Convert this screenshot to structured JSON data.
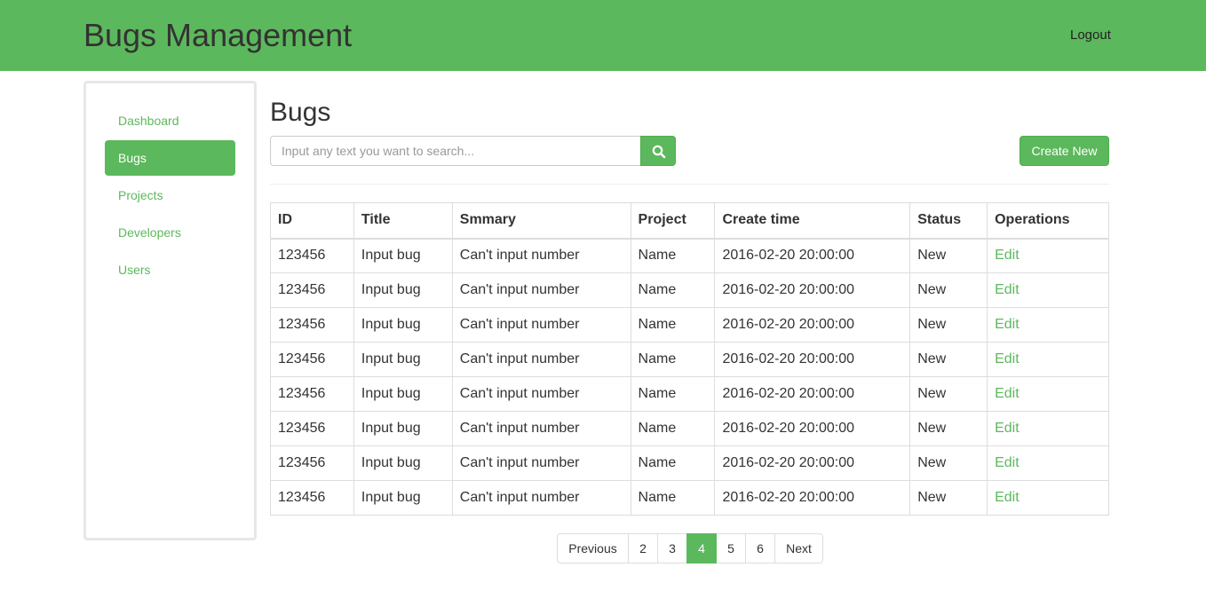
{
  "colors": {
    "accent": "#5cb85c",
    "header_bg": "#5cb85c",
    "border": "#dddddd"
  },
  "header": {
    "title": "Bugs Management",
    "logout_label": "Logout"
  },
  "sidebar": {
    "items": [
      {
        "label": "Dashboard",
        "active": false
      },
      {
        "label": "Bugs",
        "active": true
      },
      {
        "label": "Projects",
        "active": false
      },
      {
        "label": "Developers",
        "active": false
      },
      {
        "label": "Users",
        "active": false
      }
    ]
  },
  "main": {
    "title": "Bugs",
    "search": {
      "placeholder": "Input any text you want to search...",
      "value": "",
      "button_icon": "search-icon"
    },
    "create_label": "Create New"
  },
  "table": {
    "columns": [
      "ID",
      "Title",
      "Smmary",
      "Project",
      "Create time",
      "Status",
      "Operations"
    ],
    "rows": [
      [
        "123456",
        "Input bug",
        "Can't input number",
        "Name",
        "2016-02-20 20:00:00",
        "New",
        "Edit"
      ],
      [
        "123456",
        "Input bug",
        "Can't input number",
        "Name",
        "2016-02-20 20:00:00",
        "New",
        "Edit"
      ],
      [
        "123456",
        "Input bug",
        "Can't input number",
        "Name",
        "2016-02-20 20:00:00",
        "New",
        "Edit"
      ],
      [
        "123456",
        "Input bug",
        "Can't input number",
        "Name",
        "2016-02-20 20:00:00",
        "New",
        "Edit"
      ],
      [
        "123456",
        "Input bug",
        "Can't input number",
        "Name",
        "2016-02-20 20:00:00",
        "New",
        "Edit"
      ],
      [
        "123456",
        "Input bug",
        "Can't input number",
        "Name",
        "2016-02-20 20:00:00",
        "New",
        "Edit"
      ],
      [
        "123456",
        "Input bug",
        "Can't input number",
        "Name",
        "2016-02-20 20:00:00",
        "New",
        "Edit"
      ],
      [
        "123456",
        "Input bug",
        "Can't input number",
        "Name",
        "2016-02-20 20:00:00",
        "New",
        "Edit"
      ]
    ]
  },
  "pagination": {
    "previous_label": "Previous",
    "pages": [
      "2",
      "3",
      "4",
      "5",
      "6"
    ],
    "current": "4",
    "next_label": "Next"
  }
}
